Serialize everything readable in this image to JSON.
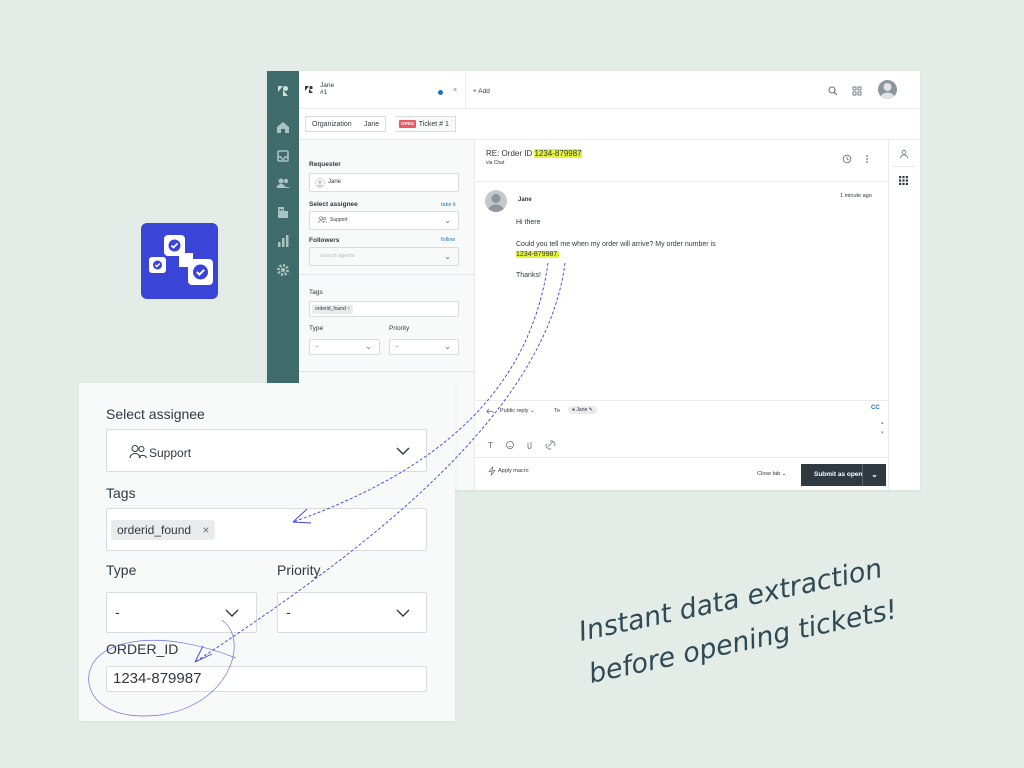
{
  "colors": {
    "background": "#e4ece7",
    "nav": "#3f6b6b",
    "app_icon": "#3a45d8",
    "highlight": "#e8f23a",
    "link": "#1f73b7",
    "open_badge": "#e35b66",
    "submit": "#2f3941",
    "arrow": "#3a45d8",
    "script": "#2f4a55"
  },
  "topbar": {
    "user_name": "Jane",
    "ticket_num": "#1",
    "add_label": "+ Add",
    "close_glyph": "×",
    "icons": [
      "search-icon",
      "apps-grid-icon",
      "user-avatar"
    ]
  },
  "nav_icons": [
    "zendesk-logo-icon",
    "home-icon",
    "inbox-icon",
    "users-icon",
    "building-icon",
    "reports-icon",
    "settings-icon"
  ],
  "breadcrumb": {
    "organization": "Organization",
    "requester": "Jane",
    "status_badge": "OPEN",
    "ticket": "Ticket # 1",
    "next_glyph": "›"
  },
  "sidebar": {
    "requester_label": "Requester",
    "requester_value": "Jane",
    "assignee_label": "Select assignee",
    "take_it": "take it",
    "assignee_value": "Support",
    "followers_label": "Followers",
    "follow": "follow",
    "followers_placeholder": "search agents",
    "tags_label": "Tags",
    "tag": "orderid_found",
    "type_label": "Type",
    "type_value": "-",
    "priority_label": "Priority",
    "priority_value": "-"
  },
  "conversation": {
    "subject_prefix": "RE: Order ID ",
    "subject_order": "1234-879987",
    "via": "via Chat",
    "author": "Jane",
    "time": "1 minute ago",
    "greeting": "Hi there",
    "body": "Could you tell me when my order will arrive? My order number is",
    "order_number": "1234-879987.",
    "sign_off": "Thanks!"
  },
  "composer": {
    "reply_type": "Public reply",
    "to_label": "To",
    "to_value": "Jane",
    "cc": "CC",
    "apply_macro": "Apply macro",
    "close_tab": "Close tab",
    "submit": "Submit as open"
  },
  "zoom_panel": {
    "assignee_label": "Select assignee",
    "assignee_value": "Support",
    "tags_label": "Tags",
    "tag": "orderid_found",
    "tag_remove": "×",
    "type_label": "Type",
    "type_value": "-",
    "priority_label": "Priority",
    "priority_value": "-",
    "order_id_label": "ORDER_ID",
    "order_id_value": "1234-879987"
  },
  "handwriting": {
    "line1": "Instant data extraction",
    "line2": "before opening tickets!"
  }
}
